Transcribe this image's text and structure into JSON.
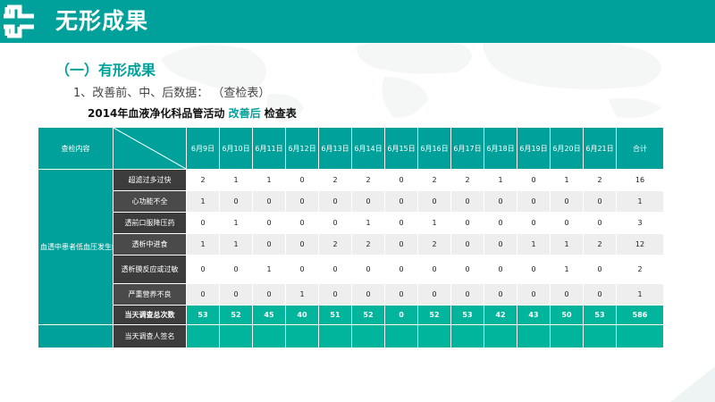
{
  "header": {
    "title": "无形成果",
    "brand_color": "#00a19a"
  },
  "section": {
    "title": "（一）有形成果",
    "subtitle": "1、改善前、中、后数据：  （查检表）"
  },
  "caption": {
    "part1": "2014年血液净化科品管活动",
    "part2": "改善后",
    "part3": "检查表"
  },
  "table": {
    "header_label": "查检内容",
    "dates": [
      "6月9日",
      "6月10日",
      "6月11日",
      "6月12日",
      "6月13日",
      "6月14日",
      "6月15日",
      "6月16日",
      "6月17日",
      "6月18日",
      "6月19日",
      "6月20日",
      "6月21日"
    ],
    "total_header": "合计",
    "group_label": "血透中患者低血压发生的次数",
    "rows": [
      {
        "label": "超滤过多过快",
        "values": [
          "2",
          "1",
          "1",
          "0",
          "2",
          "2",
          "0",
          "2",
          "2",
          "1",
          "0",
          "1",
          "2"
        ],
        "total": "16"
      },
      {
        "label": "心功能不全",
        "values": [
          "1",
          "0",
          "0",
          "0",
          "0",
          "0",
          "0",
          "0",
          "0",
          "0",
          "0",
          "0",
          "0"
        ],
        "total": "1"
      },
      {
        "label": "透前口服降压药",
        "values": [
          "0",
          "1",
          "0",
          "0",
          "0",
          "1",
          "0",
          "1",
          "0",
          "0",
          "0",
          "0",
          "0"
        ],
        "total": "3"
      },
      {
        "label": "透析中进食",
        "values": [
          "1",
          "1",
          "0",
          "0",
          "2",
          "2",
          "0",
          "2",
          "0",
          "0",
          "1",
          "1",
          "2"
        ],
        "total": "12"
      },
      {
        "label": "透析膜反应或过敏",
        "values": [
          "0",
          "0",
          "1",
          "0",
          "0",
          "0",
          "0",
          "0",
          "0",
          "0",
          "0",
          "1",
          "0"
        ],
        "total": "2"
      },
      {
        "label": "严重营养不良",
        "values": [
          "0",
          "0",
          "0",
          "1",
          "0",
          "0",
          "0",
          "0",
          "0",
          "0",
          "0",
          "0",
          "0"
        ],
        "total": "1"
      }
    ],
    "daily_total": {
      "label": "当天调查总次数",
      "values": [
        "53",
        "52",
        "45",
        "40",
        "51",
        "52",
        "0",
        "52",
        "53",
        "42",
        "43",
        "50",
        "53"
      ],
      "total": "586"
    },
    "signature": {
      "label": "当天调查人签名"
    }
  }
}
